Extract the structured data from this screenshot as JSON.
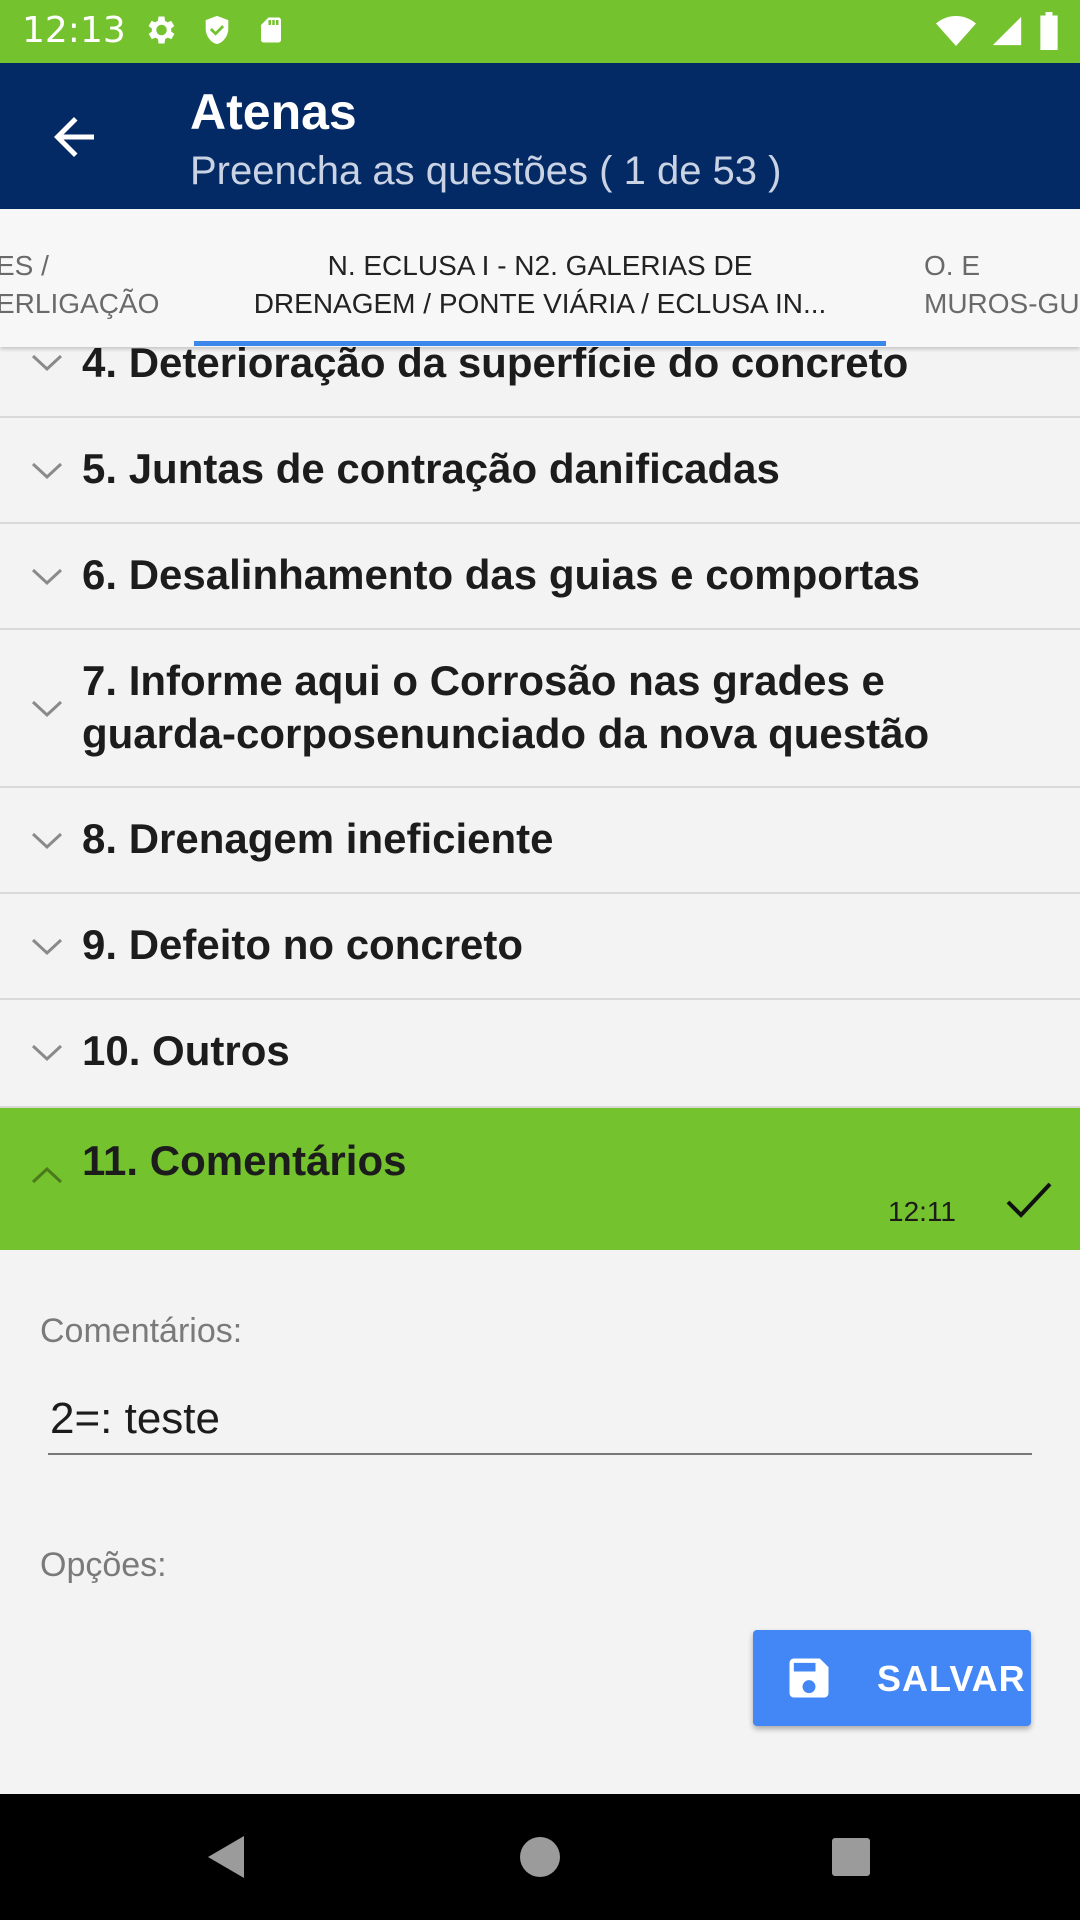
{
  "status_bar": {
    "time": "12:13",
    "left_icons": [
      "gear-icon",
      "shield-icon",
      "sd-card-icon"
    ],
    "right_icons": [
      "wifi-icon",
      "signal-icon",
      "battery-icon"
    ],
    "background": "#74c22d"
  },
  "app_bar": {
    "title": "Atenas",
    "subtitle": "Preencha as questões ( 1 de 53 )",
    "background": "#042a66"
  },
  "tabs": {
    "left": {
      "line1": "ES /",
      "line2": "ERLIGAÇÃO"
    },
    "active": {
      "line1": "N. ECLUSA I - N2. GALERIAS DE",
      "line2": "DRENAGEM / PONTE VIÁRIA / ECLUSA IN..."
    },
    "right": {
      "line1": "O. E",
      "line2": "MUROS-GU"
    },
    "indicator_color": "#3b87ea"
  },
  "questions": [
    {
      "label": "4. Deterioração da superfície do concreto",
      "expanded": false
    },
    {
      "label": "5. Juntas de contração danificadas",
      "expanded": false
    },
    {
      "label": "6. Desalinhamento das guias e comportas",
      "expanded": false
    },
    {
      "label_line1": "7. Informe aqui o Corrosão nas grades e",
      "label_line2": "guarda-corposenunciado da nova questão",
      "expanded": false
    },
    {
      "label": "8. Drenagem ineficiente",
      "expanded": false
    },
    {
      "label": "9. Defeito no concreto",
      "expanded": false
    },
    {
      "label": "10. Outros",
      "expanded": false
    },
    {
      "label": "11. Comentários",
      "expanded": true,
      "time": "12:11",
      "answered": true
    }
  ],
  "form": {
    "comment_label": "Comentários:",
    "comment_value": "2=: teste",
    "options_label": "Opções:",
    "save_label": "SALVAR",
    "save_color": "#4287f5",
    "answered_color": "#74c22d"
  }
}
